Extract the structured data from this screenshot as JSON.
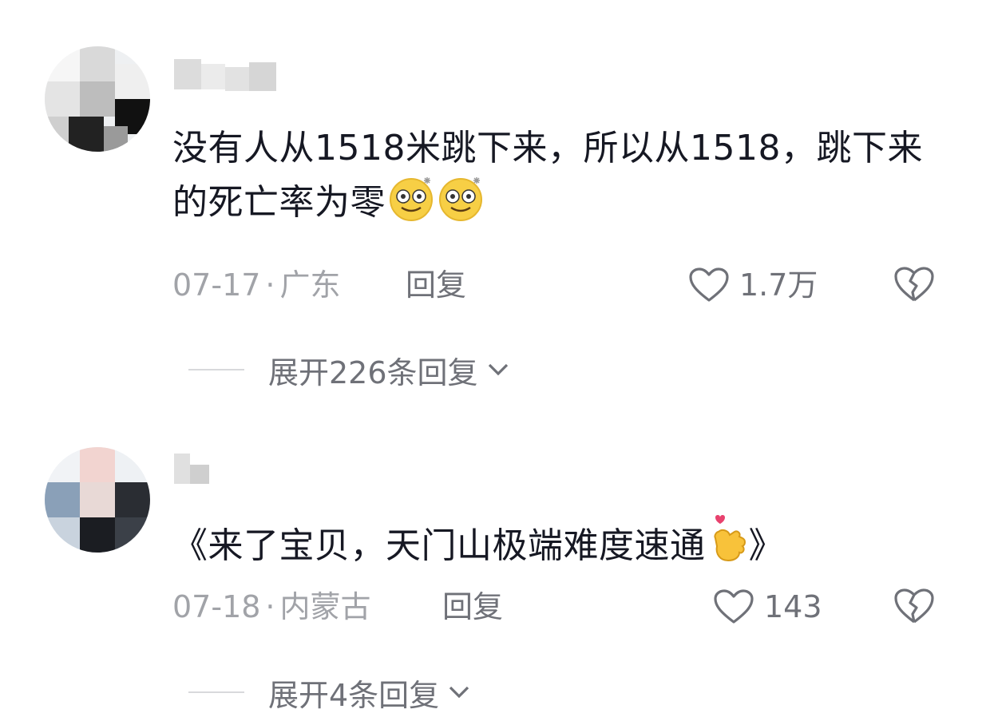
{
  "comments": [
    {
      "text": "没有人从1518米跳下来，所以从1518，跳下来的死亡率为零",
      "emojis": [
        "dizzy-face-emoji",
        "dizzy-face-emoji"
      ],
      "date": "07-17",
      "location": "广东",
      "reply_label": "回复",
      "likes": "1.7万",
      "expand_label": "展开226条回复"
    },
    {
      "text_open": "《来了宝贝，天门山极端难度速通",
      "emoji": "heart-fingers-emoji",
      "text_close": "》",
      "date": "07-18",
      "location": "内蒙古",
      "reply_label": "回复",
      "likes": "143",
      "expand_label": "展开4条回复"
    }
  ],
  "separator": "·",
  "colors": {
    "text": "#161823",
    "meta": "#a1a3a8",
    "action": "#6f7178"
  }
}
